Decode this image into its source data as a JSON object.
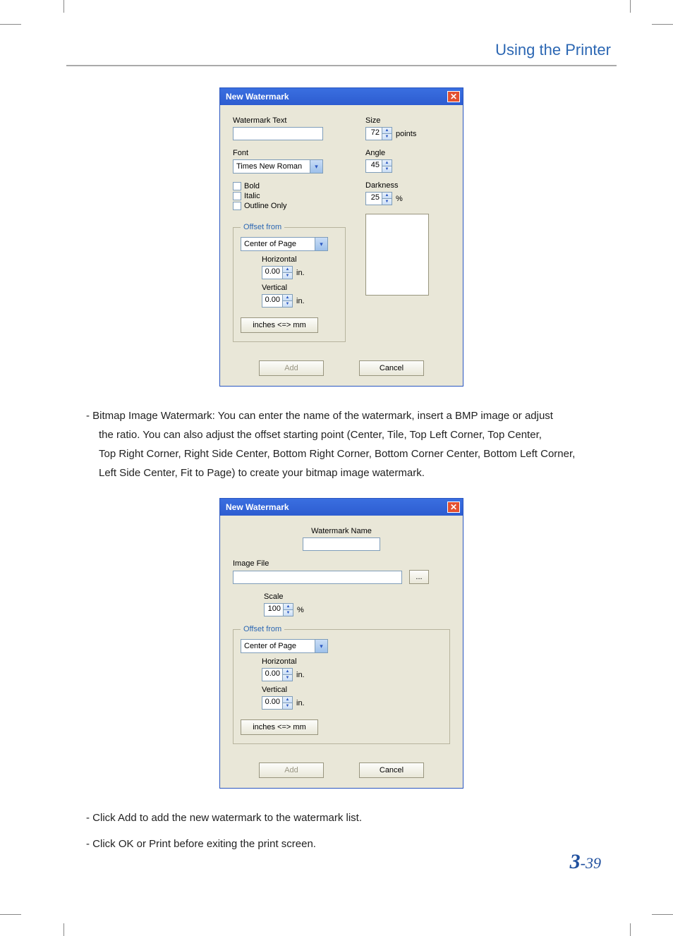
{
  "header": {
    "title": "Using the Printer"
  },
  "dialog1": {
    "title": "New Watermark",
    "watermark_text_label": "Watermark Text",
    "watermark_text_value": "",
    "font_label": "Font",
    "font_value": "Times New Roman",
    "bold_label": "Bold",
    "italic_label": "Italic",
    "outline_label": "Outline Only",
    "size_label": "Size",
    "size_value": "72",
    "size_unit": "points",
    "angle_label": "Angle",
    "angle_value": "45",
    "darkness_label": "Darkness",
    "darkness_value": "25",
    "darkness_unit": "%",
    "offset_legend": "Offset from",
    "offset_value": "Center of Page",
    "horizontal_label": "Horizontal",
    "horizontal_value": "0.00",
    "vertical_label": "Vertical",
    "vertical_value": "0.00",
    "unit_in": "in.",
    "toggle_units": "inches <=> mm",
    "add_label": "Add",
    "cancel_label": "Cancel"
  },
  "para1_lines": {
    "l1": "-  Bitmap Image Watermark: You can enter the name of the watermark, insert a BMP image or adjust",
    "l2": "the ratio. You can also adjust the offset starting point (Center, Tile, Top Left Corner, Top Center,",
    "l3": "Top Right Corner, Right Side Center, Bottom Right Corner, Bottom Corner Center, Bottom Left Corner,",
    "l4": "Left Side Center, Fit to Page) to create your bitmap image watermark."
  },
  "dialog2": {
    "title": "New Watermark",
    "name_label": "Watermark Name",
    "name_value": "",
    "image_label": "Image File",
    "image_value": "",
    "browse_label": "...",
    "scale_label": "Scale",
    "scale_value": "100",
    "scale_unit": "%",
    "offset_legend": "Offset from",
    "offset_value": "Center of Page",
    "horizontal_label": "Horizontal",
    "horizontal_value": "0.00",
    "vertical_label": "Vertical",
    "vertical_value": "0.00",
    "unit_in": "in.",
    "toggle_units": "inches <=> mm",
    "add_label": "Add",
    "cancel_label": "Cancel"
  },
  "para2": "-  Click Add to add the new watermark to the watermark list.",
  "para3": "-  Click OK or Print before exiting the print screen.",
  "page_number": {
    "chapter": "3",
    "sep": "-",
    "page": "39"
  }
}
